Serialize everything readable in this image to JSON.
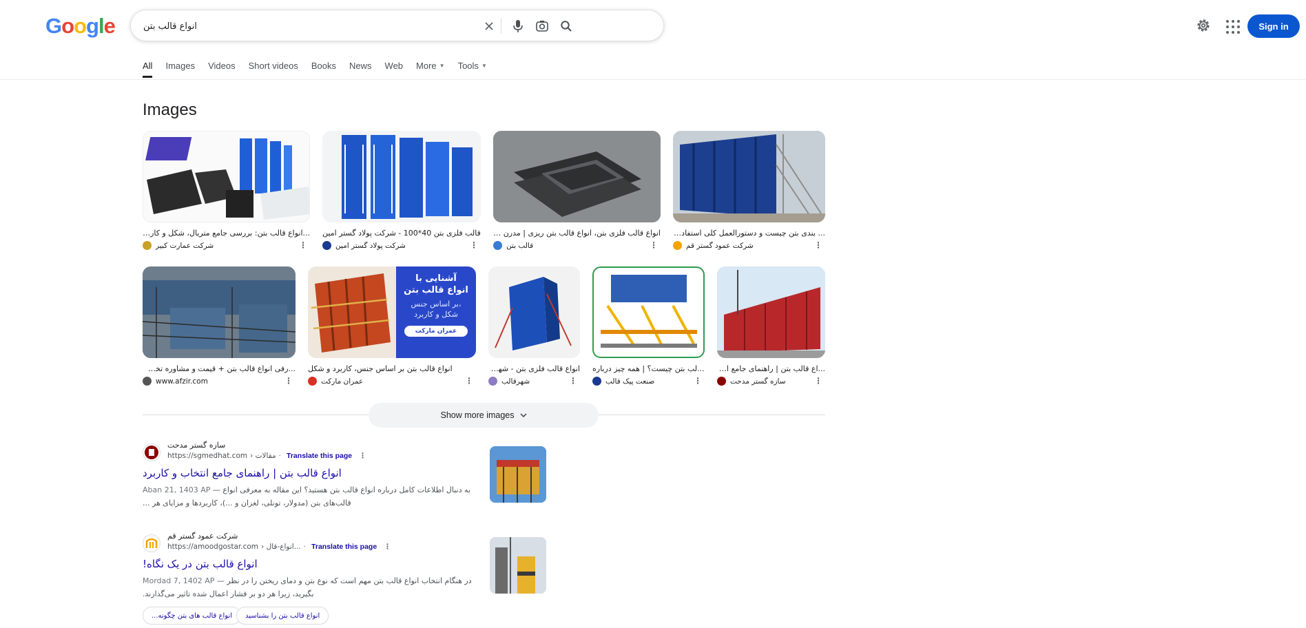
{
  "logo": {
    "letters": [
      "G",
      "o",
      "o",
      "g",
      "l",
      "e"
    ],
    "colors": [
      "#4285f4",
      "#ea4335",
      "#fbbc05",
      "#4285f4",
      "#34a853",
      "#ea4335"
    ]
  },
  "search": {
    "value": "انواع قالب بتن"
  },
  "header": {
    "signin_label": "Sign in"
  },
  "tabs": [
    {
      "label": "All",
      "active": true
    },
    {
      "label": "Images"
    },
    {
      "label": "Videos"
    },
    {
      "label": "Short videos"
    },
    {
      "label": "Books"
    },
    {
      "label": "News"
    },
    {
      "label": "Web"
    },
    {
      "label": "More",
      "caret": true
    },
    {
      "label": "Tools",
      "caret": true
    }
  ],
  "images": {
    "heading": "Images",
    "row1": [
      {
        "title": "...انواع قالب بتن: بررسی جامع متریال، شکل و کاربرد - عما",
        "source": "شرکت عمارت کبیر",
        "fav_color": "#c9a227"
      },
      {
        "title": "قالب فلزی بتن 40*100 - شرکت پولاد گستر امین",
        "source": "شرکت پولاد گستر امین",
        "fav_color": "#1a3a8f"
      },
      {
        "title": "انواع قالب فلزی بتن، انواع قالب بتن ریزی | مدرن سازان",
        "source": "قالب بتن",
        "fav_color": "#3a7bd5"
      },
      {
        "title": "... بندی بتن چیست و دستورالعمل کلی استفاده قالب",
        "source": "شرکت عمود گستر قم",
        "fav_color": "#f4a300"
      }
    ],
    "row2": [
      {
        "title": "...رفی انواع قالب بتن + قیمت و مشاوره تخصصی",
        "source": "www.afzir.com",
        "fav_color": "#555555"
      },
      {
        "title": "انواع قالب بتن بر اساس جنس، کاربرد و شکل",
        "source": "عمران مارکت",
        "fav_color": "#d93025"
      },
      {
        "title": "انواع قالب فلزی بتن - شهرقالب",
        "source": "شهرقالب",
        "fav_color": "#8e7cc3"
      },
      {
        "title": "...لب بتن چیست؟ | همه چیز درباره",
        "source": "صنعت پیک قالب",
        "fav_color": "#1a3a8f"
      },
      {
        "title": "...اع قالب بتن | راهنمای جامع انتخا",
        "source": "سازه گستر مدحت",
        "fav_color": "#8b0000"
      }
    ],
    "promo": {
      "line1": "آشنایی با",
      "line2": "انواع قالب بتن",
      "line3": "بر اساس جنس،",
      "line4": "شکل و کاربرد",
      "brand": "عمران مارکت"
    },
    "show_more_label": "Show more images"
  },
  "results": [
    {
      "site": "سازه گستر مدحت",
      "url": "https://sgmedhat.com",
      "path": "› مقالات",
      "translate": "Translate this page",
      "title": "انواع قالب بتن | راهنمای جامع انتخاب و کاربرد",
      "date": "Aban 21, 1403 AP",
      "snippet": "به دنبال اطلاعات کامل درباره انواع قالب بتن هستید؟ این مقاله به معرفی انواع قالب‌های بتن (مدولار، تونلی، لغزان و ...)، کاربردها و مزایای هر ...",
      "fav_color": "#8b0000"
    },
    {
      "site": "شرکت عمود گستر قم",
      "url": "https://amoodgostar.com",
      "path": "› انواع-قال...",
      "translate": "Translate this page",
      "title": "انواع قالب بتن در یک نگاه!",
      "date": "Mordad 7, 1402 AP",
      "snippet": "در هنگام انتخاب انواع قالب بتن مهم است که نوع بتن و دمای ریختن را در نظر بگیرید، زیرا هر دو بر فشار اعمال شده تاثیر می‌گذارند.",
      "fav_color": "#f4a300"
    }
  ],
  "chips": [
    "انواع قالب های بتن چگونه...",
    "انواع قالب بتن را بشناسید"
  ]
}
